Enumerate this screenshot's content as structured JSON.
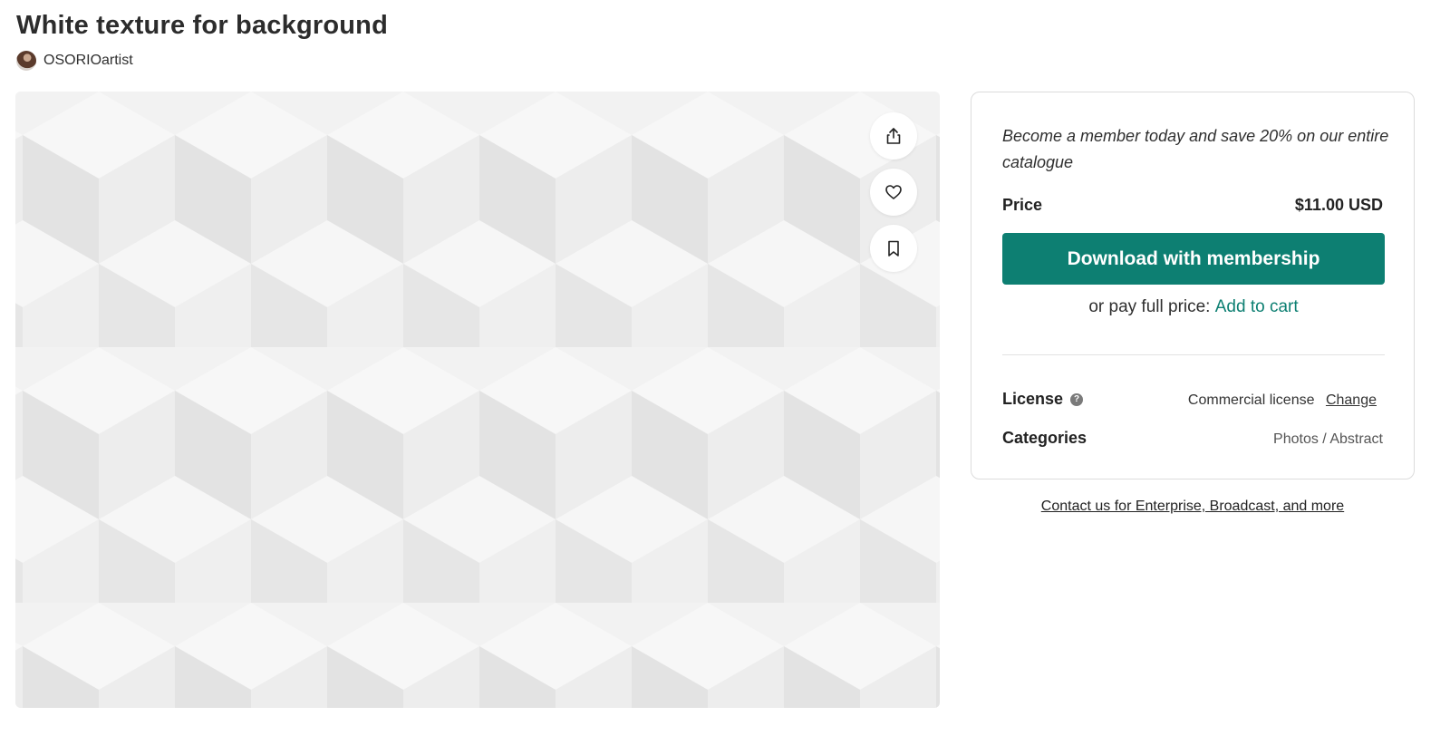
{
  "header": {
    "title": "White texture for background",
    "author": "OSORIOartist"
  },
  "preview": {
    "image_description_icon": "image-preview",
    "actions": [
      {
        "name": "share-icon"
      },
      {
        "name": "heart-icon"
      },
      {
        "name": "bookmark-icon"
      }
    ]
  },
  "panel": {
    "promo": "Become a member today and save 20% on our entire catalogue",
    "price_label": "Price",
    "price_value": "$11.00 USD",
    "download_label": "Download with membership",
    "alt_price_prefix": "or pay full price:",
    "add_to_cart": "Add to cart",
    "license_label": "License",
    "license_value": "Commercial license",
    "license_change": "Change",
    "categories_label": "Categories",
    "categories_value": "Photos / Abstract"
  },
  "footer": {
    "contact": "Contact us for Enterprise, Broadcast, and more"
  },
  "colors": {
    "accent": "#0d7f72",
    "panel_border": "#dcdcdc"
  }
}
